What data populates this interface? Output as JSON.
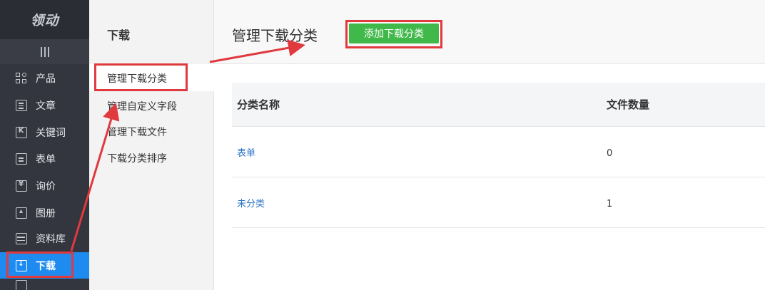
{
  "sidebar": {
    "logo": "领动",
    "items": [
      {
        "label": "产品",
        "icon": "grid-icon"
      },
      {
        "label": "文章",
        "icon": "document-icon"
      },
      {
        "label": "关键词",
        "icon": "keyword-icon"
      },
      {
        "label": "表单",
        "icon": "clipboard-icon"
      },
      {
        "label": "询价",
        "icon": "inquiry-icon"
      },
      {
        "label": "图册",
        "icon": "image-icon"
      },
      {
        "label": "资料库",
        "icon": "database-icon"
      },
      {
        "label": "下载",
        "icon": "download-icon"
      }
    ]
  },
  "subnav": {
    "title": "下载",
    "items": [
      "管理下载分类",
      "管理自定义字段",
      "管理下载文件",
      "下载分类排序"
    ]
  },
  "header": {
    "title": "管理下载分类",
    "add_button": "添加下载分类"
  },
  "table": {
    "columns": [
      "分类名称",
      "文件数量"
    ],
    "rows": [
      {
        "name": "表单",
        "count": "0"
      },
      {
        "name": "未分类",
        "count": "1"
      }
    ]
  },
  "colors": {
    "sidebar_bg": "#33363e",
    "active_blue": "#1e8bf0",
    "button_green": "#41b94a",
    "annotation_red": "#e0393e",
    "link_blue": "#2a73c7"
  }
}
